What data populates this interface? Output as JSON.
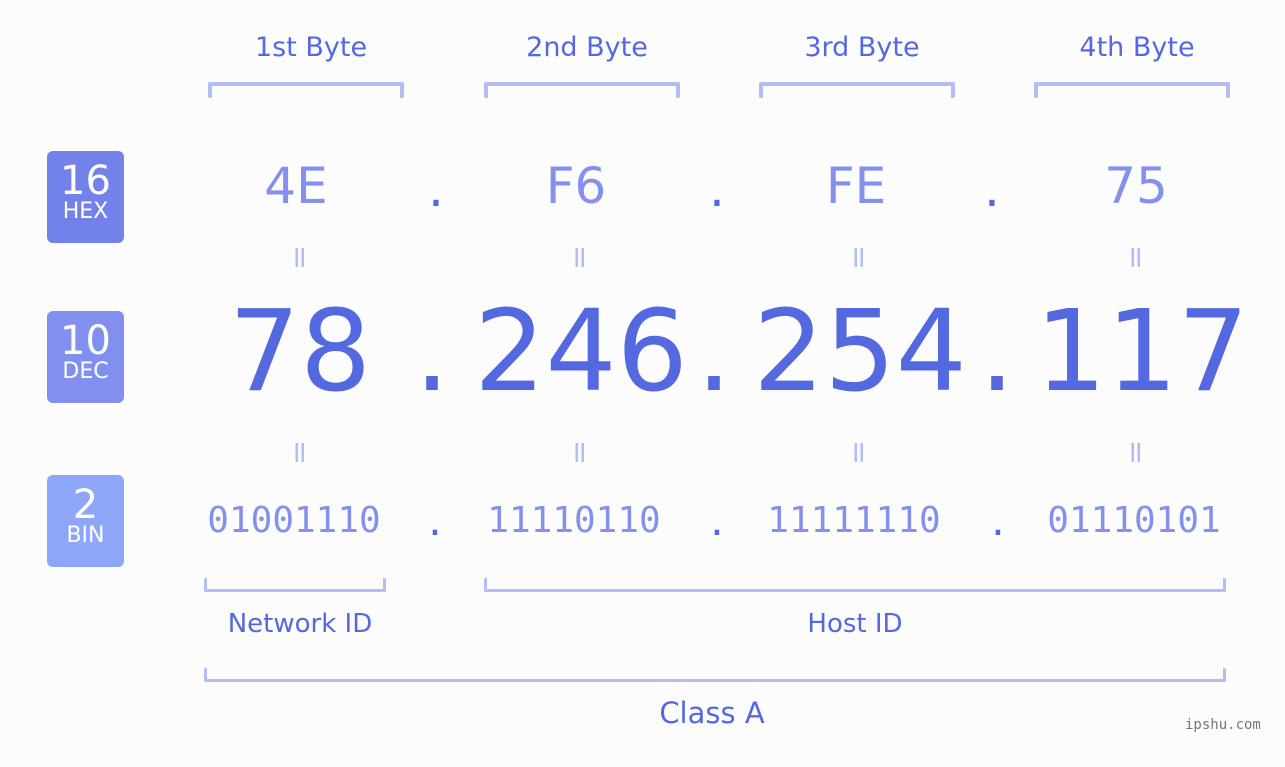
{
  "bytes": [
    {
      "label": "1st Byte",
      "hex": "4E",
      "dec": "78",
      "bin": "01001110"
    },
    {
      "label": "2nd Byte",
      "hex": "F6",
      "dec": "246",
      "bin": "11110110"
    },
    {
      "label": "3rd Byte",
      "hex": "FE",
      "dec": "254",
      "bin": "11111110"
    },
    {
      "label": "4th Byte",
      "hex": "75",
      "dec": "117",
      "bin": "01110101"
    }
  ],
  "badges": {
    "hex": {
      "num": "16",
      "label": "HEX",
      "color": "#7382ea"
    },
    "dec": {
      "num": "10",
      "label": "DEC",
      "color": "#8190ef"
    },
    "bin": {
      "num": "2",
      "label": "BIN",
      "color": "#8ea6f8"
    }
  },
  "separator": ".",
  "equals": "=",
  "parts": {
    "network": "Network ID",
    "host": "Host ID",
    "class": "Class A"
  },
  "footer": "ipshu.com",
  "colors": {
    "accent": "#5468e0",
    "light": "#8390ee",
    "bracket": "#b2bcf6"
  }
}
